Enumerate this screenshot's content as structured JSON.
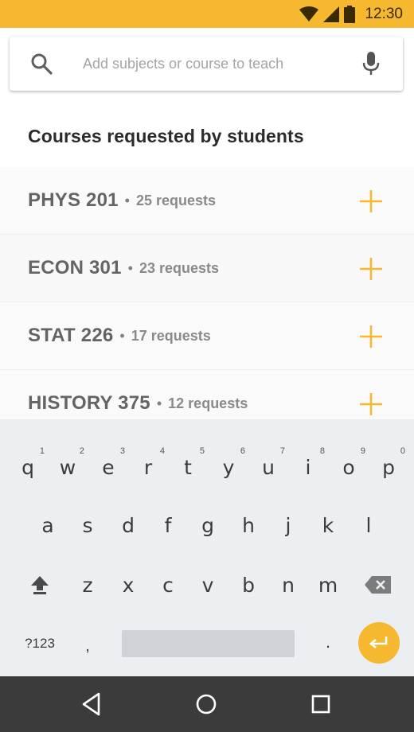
{
  "status_bar": {
    "time": "12:30",
    "icons": [
      "wifi-icon",
      "signal-icon",
      "battery-icon"
    ],
    "color": "#f5b82e"
  },
  "search": {
    "placeholder": "Add subjects or course to teach",
    "value": ""
  },
  "section": {
    "title": "Courses requested by students"
  },
  "courses": [
    {
      "code": "PHYS 201",
      "requests": "25 requests"
    },
    {
      "code": "ECON 301",
      "requests": "23 requests"
    },
    {
      "code": "STAT 226",
      "requests": "17 requests"
    },
    {
      "code": "HISTORY 375",
      "requests": "12 requests"
    }
  ],
  "keyboard": {
    "row1": [
      {
        "key": "q",
        "hint": "1"
      },
      {
        "key": "w",
        "hint": "2"
      },
      {
        "key": "e",
        "hint": "3"
      },
      {
        "key": "r",
        "hint": "4"
      },
      {
        "key": "t",
        "hint": "5"
      },
      {
        "key": "y",
        "hint": "6"
      },
      {
        "key": "u",
        "hint": "7"
      },
      {
        "key": "i",
        "hint": "8"
      },
      {
        "key": "o",
        "hint": "9"
      },
      {
        "key": "p",
        "hint": "0"
      }
    ],
    "row2": [
      "a",
      "s",
      "d",
      "f",
      "g",
      "h",
      "j",
      "k",
      "l"
    ],
    "row3": [
      "z",
      "x",
      "c",
      "v",
      "b",
      "n",
      "m"
    ],
    "symbols_label": "?123",
    "comma": ",",
    "period": ".",
    "accent_color": "#f5b82e"
  },
  "nav": {
    "buttons": [
      "back-icon",
      "home-icon",
      "recents-icon"
    ]
  }
}
